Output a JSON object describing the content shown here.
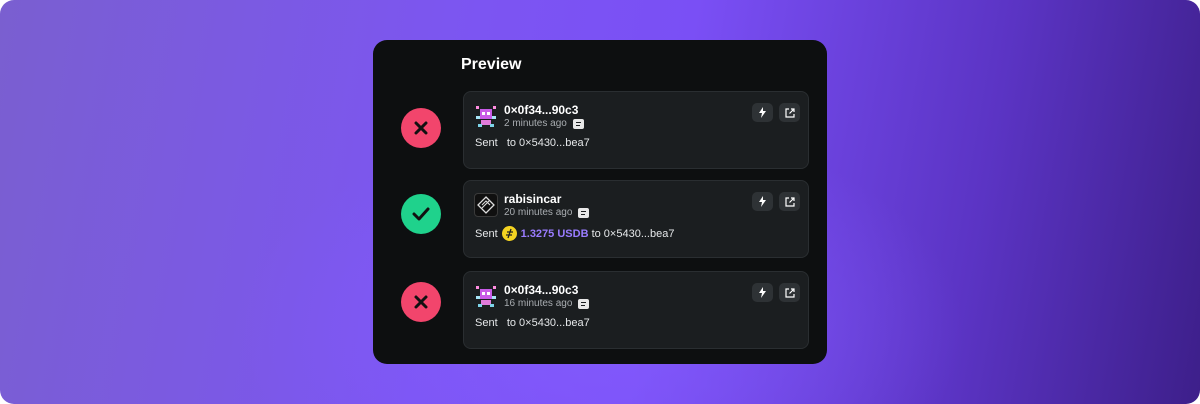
{
  "preview": {
    "title": "Preview",
    "items": [
      {
        "status": "failed",
        "name": "0×0f34...90c3",
        "time": "2 minutes ago",
        "action": "Sent",
        "amount": "",
        "recipient": "to 0×5430...bea7"
      },
      {
        "status": "success",
        "name": "rabisincar",
        "time": "20 minutes ago",
        "action": "Sent",
        "amount": "1.3275 USDB",
        "recipient": "to 0×5430...bea7"
      },
      {
        "status": "failed",
        "name": "0×0f34...90c3",
        "time": "16 minutes ago",
        "action": "Sent",
        "amount": "",
        "recipient": "to 0×5430...bea7"
      }
    ]
  },
  "colors": {
    "fail": "#f2456c",
    "success": "#1fd28c",
    "accent": "#9a7cff",
    "token": "#f4d321"
  },
  "icons": [
    "x-icon",
    "check-icon",
    "lightning-icon",
    "external-link-icon",
    "document-icon",
    "token-icon",
    "pixel-avatar",
    "logo-avatar"
  ]
}
